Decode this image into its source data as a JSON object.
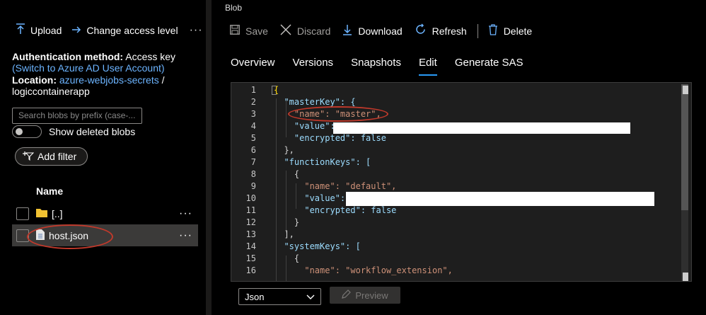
{
  "left_toolbar": {
    "upload_label": "Upload",
    "change_access_label": "Change access level",
    "more_label": "···"
  },
  "auth": {
    "method_label": "Authentication method:",
    "method_value": "Access key",
    "switch_link": "(Switch to Azure AD User Account)",
    "location_label": "Location:",
    "location_link": "azure-webjobs-secrets",
    "location_sep": "/",
    "location_path": "logiccontainerapp"
  },
  "search": {
    "placeholder": "Search blobs by prefix (case-..."
  },
  "show_deleted": {
    "label": "Show deleted blobs",
    "on": false
  },
  "add_filter_label": "Add filter",
  "list": {
    "column_name": "Name",
    "rows": [
      {
        "name": "[..]",
        "icon": "folder-icon",
        "selected": false
      },
      {
        "name": "host.json",
        "icon": "file-icon",
        "selected": true
      }
    ],
    "row_more": "···"
  },
  "blob_label": "Blob",
  "right_toolbar": {
    "save": "Save",
    "discard": "Discard",
    "download": "Download",
    "refresh": "Refresh",
    "delete": "Delete"
  },
  "tabs": [
    "Overview",
    "Versions",
    "Snapshots",
    "Edit",
    "Generate SAS"
  ],
  "active_tab": "Edit",
  "editor": {
    "lines": [
      {
        "n": "1",
        "text": "{"
      },
      {
        "n": "2",
        "text": "  \"masterKey\": {"
      },
      {
        "n": "3",
        "text": "    \"name\": \"master\","
      },
      {
        "n": "4",
        "text": "    \"value\":"
      },
      {
        "n": "5",
        "text": "    \"encrypted\": false"
      },
      {
        "n": "6",
        "text": "  },"
      },
      {
        "n": "7",
        "text": "  \"functionKeys\": ["
      },
      {
        "n": "8",
        "text": "    {"
      },
      {
        "n": "9",
        "text": "      \"name\": \"default\","
      },
      {
        "n": "10",
        "text": "      \"value\":"
      },
      {
        "n": "11",
        "text": "      \"encrypted\": false"
      },
      {
        "n": "12",
        "text": "    }"
      },
      {
        "n": "13",
        "text": "  ],"
      },
      {
        "n": "14",
        "text": "  \"systemKeys\": ["
      },
      {
        "n": "15",
        "text": "    {"
      },
      {
        "n": "16",
        "text": "      \"name\": \"workflow_extension\","
      }
    ]
  },
  "language_select": {
    "value": "Json"
  },
  "preview_label": "Preview",
  "colors": {
    "accent": "#2899f5",
    "link": "#6cb4ff",
    "annotation": "#c0392b"
  }
}
